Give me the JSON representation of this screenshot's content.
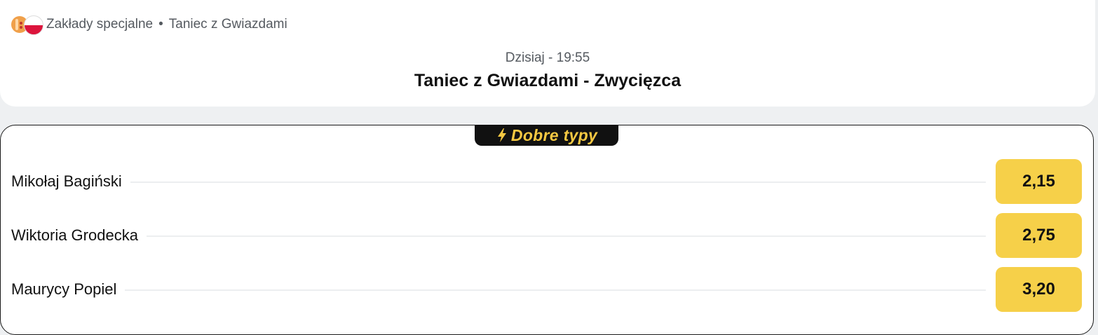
{
  "header": {
    "breadcrumb": {
      "category": "Zakłady specjalne",
      "separator": "•",
      "event": "Taniec z Gwiazdami"
    },
    "time": "Dzisiaj - 19:55",
    "title": "Taniec z Gwiazdami - Zwycięzca"
  },
  "market": {
    "badge_label": "Dobre typy",
    "badge_icon": "lightning-bolt-icon",
    "selections": [
      {
        "name": "Mikołaj Bagiński",
        "odds": "2,15"
      },
      {
        "name": "Wiktoria Grodecka",
        "odds": "2,75"
      },
      {
        "name": "Maurycy Popiel",
        "odds": "3,20"
      }
    ]
  },
  "colors": {
    "accent": "#f6d049",
    "badge_bg": "#111111",
    "badge_text": "#f5c842",
    "page_bg": "#eef0f2"
  }
}
